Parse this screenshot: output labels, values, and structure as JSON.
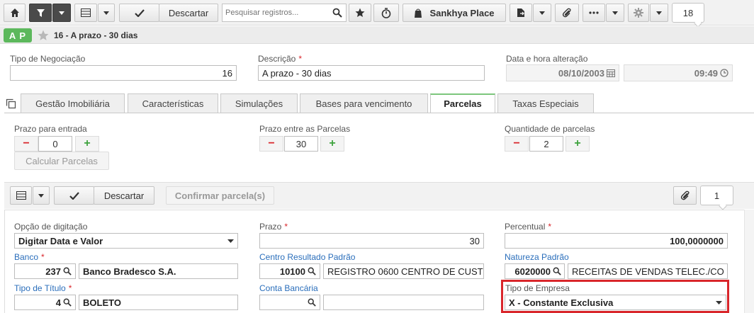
{
  "toolbar": {
    "discard_label": "Descartar",
    "search_placeholder": "Pesquisar registros...",
    "place_label": "Sankhya Place",
    "count": "18"
  },
  "record": {
    "badge": "A P",
    "title": "16 - A prazo - 30 dias"
  },
  "header_fields": {
    "tipo_label": "Tipo de Negociação",
    "tipo_value": "16",
    "descricao_label": "Descrição",
    "descricao_value": "A prazo - 30 dias",
    "data_label": "Data e hora alteração",
    "date_value": "08/10/2003",
    "time_value": "09:49"
  },
  "tabs": [
    {
      "label": "Gestão Imobiliária"
    },
    {
      "label": "Características"
    },
    {
      "label": "Simulações"
    },
    {
      "label": "Bases para vencimento"
    },
    {
      "label": "Parcelas"
    },
    {
      "label": "Taxas Especiais"
    }
  ],
  "parcelas": {
    "prazo_entrada_label": "Prazo para entrada",
    "prazo_entrada_value": "0",
    "prazo_parcelas_label": "Prazo entre as Parcelas",
    "prazo_parcelas_value": "30",
    "qtd_label": "Quantidade de parcelas",
    "qtd_value": "2",
    "calc_label": "Calcular Parcelas"
  },
  "subtoolbar": {
    "discard_label": "Descartar",
    "confirm_label": "Confirmar parcela(s)",
    "count": "1"
  },
  "form": {
    "opcao_label": "Opção de digitação",
    "opcao_value": "Digitar Data e Valor",
    "prazo_label": "Prazo",
    "prazo_value": "30",
    "percentual_label": "Percentual",
    "percentual_value": "100,0000000",
    "banco_label": "Banco",
    "banco_code": "237",
    "banco_name": "Banco Bradesco S.A.",
    "centro_label": "Centro Resultado Padrão",
    "centro_code": "10100",
    "centro_name": "REGISTRO 0600 CENTRO DE CUST",
    "natureza_label": "Natureza Padrão",
    "natureza_code": "6020000",
    "natureza_name": "RECEITAS DE VENDAS TELEC./CO",
    "tipo_titulo_label": "Tipo de Título",
    "tipo_titulo_code": "4",
    "tipo_titulo_name": "BOLETO",
    "conta_label": "Conta Bancária",
    "tipo_empresa_label": "Tipo de Empresa",
    "tipo_empresa_value": "X - Constante Exclusiva"
  },
  "colors": {
    "badge_green": "#5cb85c",
    "active_tab_accent": "#7dc67d",
    "required_red": "#d9262b",
    "highlight_red": "#d9262b",
    "link_blue": "#2a6ebb"
  }
}
